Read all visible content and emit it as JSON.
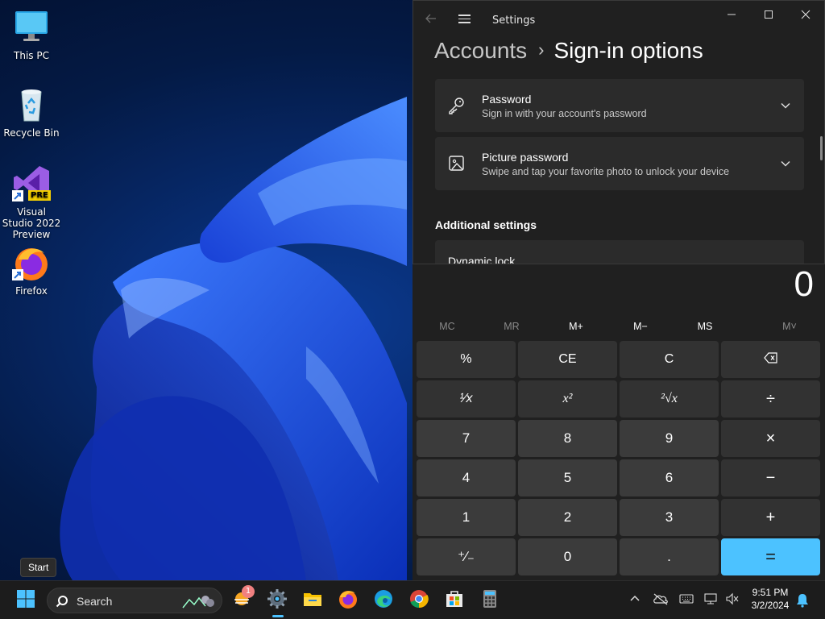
{
  "desktop": {
    "icons": [
      {
        "label": "This PC",
        "icon": "monitor-icon"
      },
      {
        "label": "Recycle Bin",
        "icon": "recycle-bin-icon"
      },
      {
        "label": "Visual Studio 2022 Preview",
        "icon": "visual-studio-icon",
        "badge": "PRE"
      },
      {
        "label": "Firefox",
        "icon": "firefox-icon"
      }
    ]
  },
  "settings": {
    "title": "Settings",
    "breadcrumb": {
      "parent": "Accounts",
      "separator": "›",
      "current": "Sign-in options"
    },
    "cards": [
      {
        "title": "Password",
        "subtitle": "Sign in with your account's password",
        "icon": "key-icon"
      },
      {
        "title": "Picture password",
        "subtitle": "Swipe and tap your favorite photo to unlock your device",
        "icon": "picture-icon"
      }
    ],
    "section_heading": "Additional settings",
    "dynamic_lock": "Dynamic lock"
  },
  "calculator": {
    "display": "0",
    "memory": [
      {
        "label": "MC",
        "enabled": false
      },
      {
        "label": "MR",
        "enabled": false
      },
      {
        "label": "M+",
        "enabled": true
      },
      {
        "label": "M−",
        "enabled": true
      },
      {
        "label": "MS",
        "enabled": true
      },
      {
        "label": "M˅",
        "enabled": false
      }
    ],
    "keys": {
      "percent": "%",
      "ce": "CE",
      "c": "C",
      "reciprocal": "¹⁄x",
      "square": "x²",
      "sqrt": "²√x",
      "divide": "÷",
      "seven": "7",
      "eight": "8",
      "nine": "9",
      "multiply": "×",
      "four": "4",
      "five": "5",
      "six": "6",
      "minus": "−",
      "one": "1",
      "two": "2",
      "three": "3",
      "plus": "+",
      "negate": "⁺∕₋",
      "zero": "0",
      "decimal": ".",
      "equals": "="
    }
  },
  "taskbar": {
    "search_placeholder": "Search",
    "tooltip": "Start",
    "widgets_badge": "1",
    "clock_time": "9:51 PM",
    "clock_date": "3/2/2024"
  },
  "colors": {
    "accent": "#4cc2ff",
    "window_bg": "#202020",
    "card_bg": "#2b2b2b"
  }
}
